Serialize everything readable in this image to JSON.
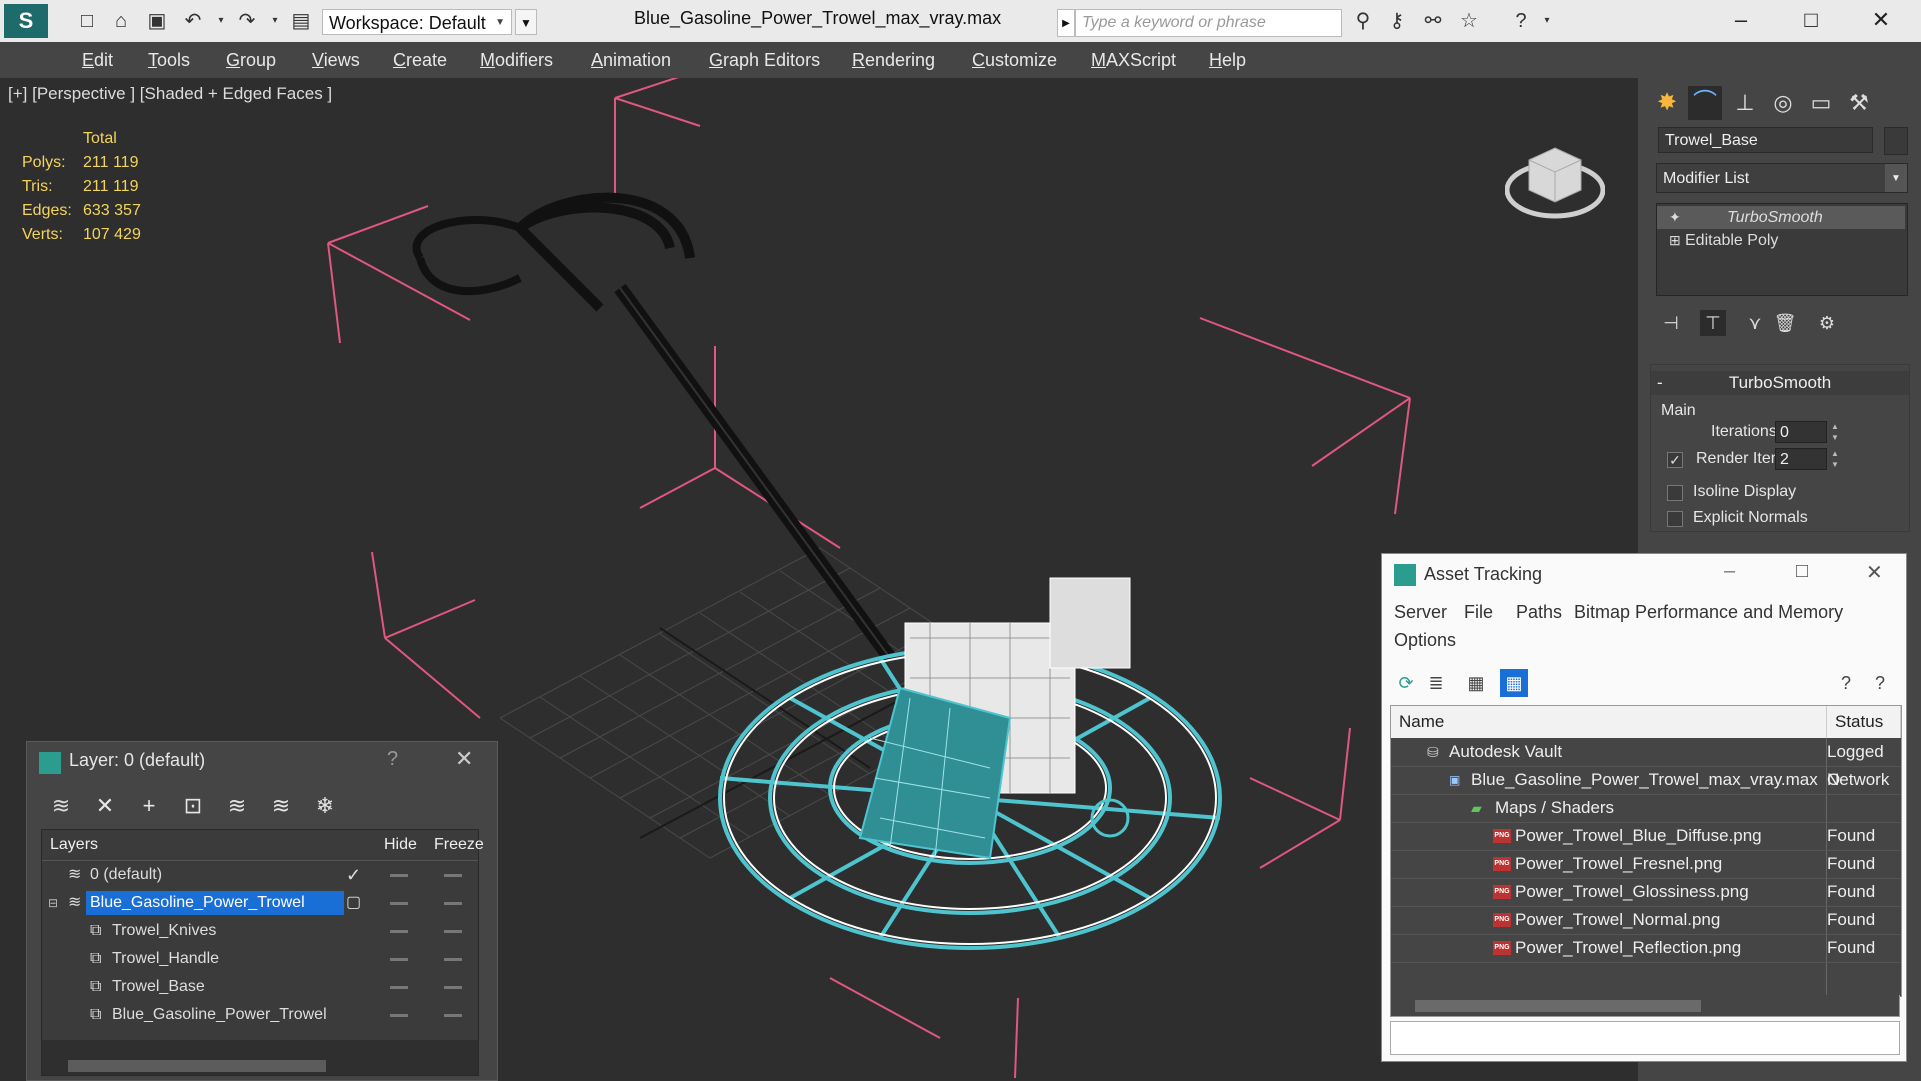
{
  "titlebar": {
    "workspace": "Workspace: Default",
    "filename": "Blue_Gasoline_Power_Trowel_max_vray.max",
    "search_placeholder": "Type a keyword or phrase"
  },
  "menu": [
    "Edit",
    "Tools",
    "Group",
    "Views",
    "Create",
    "Modifiers",
    "Animation",
    "Graph Editors",
    "Rendering",
    "Customize",
    "MAXScript",
    "Help"
  ],
  "viewport": {
    "label": "[+] [Perspective ] [Shaded + Edged Faces ]",
    "stats": {
      "header": "Total",
      "rows": [
        {
          "label": "Polys:",
          "value": "211 119"
        },
        {
          "label": "Tris:",
          "value": "211 119"
        },
        {
          "label": "Edges:",
          "value": "633 357"
        },
        {
          "label": "Verts:",
          "value": "107 429"
        }
      ]
    }
  },
  "command_panel": {
    "object_name": "Trowel_Base",
    "modifier_list": "Modifier List",
    "stack": [
      "TurboSmooth",
      "Editable Poly"
    ],
    "rollout": {
      "title": "TurboSmooth",
      "group": "Main",
      "iterations_label": "Iterations:",
      "iterations": "0",
      "render_iters_label": "Render Iters:",
      "render_iters": "2",
      "render_iters_checked": true,
      "isoline_label": "Isoline Display",
      "explicit_label": "Explicit Normals"
    }
  },
  "layer_dialog": {
    "title": "Layer: 0 (default)",
    "help": "?",
    "columns": {
      "layers": "Layers",
      "hide": "Hide",
      "freeze": "Freeze"
    },
    "rows": [
      {
        "name": "0 (default)",
        "level": 0,
        "checked": true
      },
      {
        "name": "Blue_Gasoline_Power_Trowel",
        "level": 0,
        "selected": true
      },
      {
        "name": "Trowel_Knives",
        "level": 1
      },
      {
        "name": "Trowel_Handle",
        "level": 1
      },
      {
        "name": "Trowel_Base",
        "level": 1
      },
      {
        "name": "Blue_Gasoline_Power_Trowel",
        "level": 1
      }
    ]
  },
  "asset_tracking": {
    "title": "Asset Tracking",
    "menu": [
      "Server",
      "File",
      "Paths",
      "Bitmap Performance and Memory",
      "Options"
    ],
    "columns": {
      "name": "Name",
      "status": "Status"
    },
    "rows": [
      {
        "name": "Autodesk Vault",
        "status": "Logged O",
        "level": 1
      },
      {
        "name": "Blue_Gasoline_Power_Trowel_max_vray.max",
        "status": "Network",
        "level": 2
      },
      {
        "name": "Maps / Shaders",
        "status": "",
        "level": 3
      },
      {
        "name": "Power_Trowel_Blue_Diffuse.png",
        "status": "Found",
        "level": 4
      },
      {
        "name": "Power_Trowel_Fresnel.png",
        "status": "Found",
        "level": 4
      },
      {
        "name": "Power_Trowel_Glossiness.png",
        "status": "Found",
        "level": 4
      },
      {
        "name": "Power_Trowel_Normal.png",
        "status": "Found",
        "level": 4
      },
      {
        "name": "Power_Trowel_Reflection.png",
        "status": "Found",
        "level": 4
      }
    ]
  },
  "colors": {
    "accent_select": "#1a6fd6",
    "stat_yellow": "#f2d45c",
    "bbox_pink": "#e0577f",
    "wire_teal": "#4ec4cf"
  }
}
